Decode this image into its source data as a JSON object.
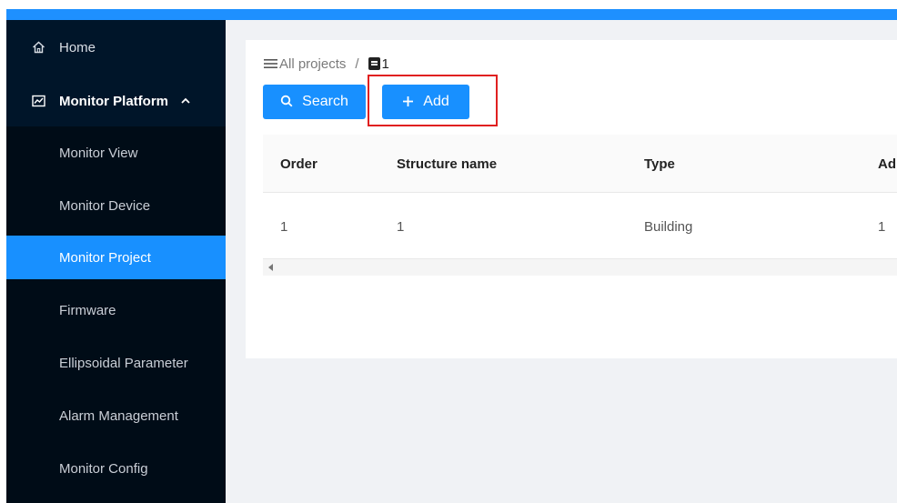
{
  "sidebar": {
    "home_label": "Home",
    "group_label": "Monitor Platform",
    "items": [
      {
        "label": "Monitor View"
      },
      {
        "label": "Monitor Device"
      },
      {
        "label": "Monitor Project"
      },
      {
        "label": "Firmware"
      },
      {
        "label": "Ellipsoidal Parameter"
      },
      {
        "label": "Alarm Management"
      },
      {
        "label": "Monitor Config"
      }
    ],
    "active_item": "Monitor Project"
  },
  "breadcrumb": {
    "root": "All projects",
    "separator": "/",
    "current": "1"
  },
  "toolbar": {
    "search_label": "Search",
    "add_label": "Add"
  },
  "table": {
    "columns": [
      "Order",
      "Structure name",
      "Type",
      "Ad"
    ],
    "rows": [
      [
        "1",
        "1",
        "Building",
        "1"
      ]
    ]
  },
  "colors": {
    "primary": "#1890ff",
    "sidebar_bg": "#001529",
    "submenu_bg": "#000c17",
    "highlight_border": "#e02020"
  }
}
